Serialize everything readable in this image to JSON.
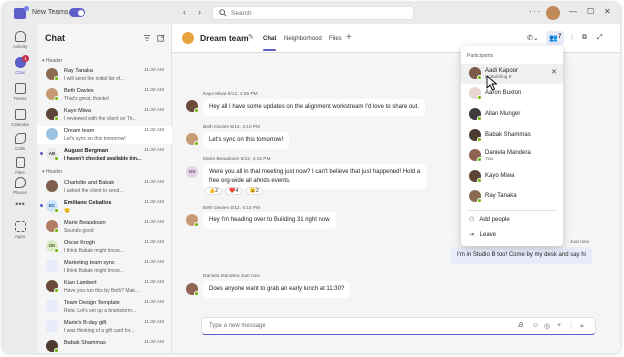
{
  "titlebar": {
    "app_name": "New Teams",
    "search_placeholder": "Search",
    "more": "···"
  },
  "rail": [
    {
      "label": "Activity",
      "active": false
    },
    {
      "label": "Chat",
      "active": true,
      "badge": "1"
    },
    {
      "label": "Teams",
      "active": false
    },
    {
      "label": "Calendar",
      "active": false
    },
    {
      "label": "Calls",
      "active": false
    },
    {
      "label": "Files",
      "active": false
    },
    {
      "label": "Places",
      "active": false
    },
    {
      "label": "Apps",
      "active": false
    }
  ],
  "rail_more": "•••",
  "chatlist": {
    "title": "Chat",
    "section1": "Header",
    "section2": "Header",
    "items": [
      {
        "initials": "",
        "name": "Ray Tanaka",
        "preview": "I will send the initial list of...",
        "time": "11:32 AM",
        "unread": false,
        "selected": false
      },
      {
        "initials": "",
        "name": "Beth Davies",
        "preview": "That's great, thanks!",
        "time": "11:32 AM",
        "unread": false,
        "selected": false
      },
      {
        "initials": "",
        "name": "Kayo Miwa",
        "preview": "I reviewed with the client on Th...",
        "time": "11:32 AM",
        "unread": false,
        "selected": false
      },
      {
        "initials": "",
        "name": "Dream team",
        "preview": "Let's sync on this tomorrow!",
        "time": "11:32 AM",
        "unread": false,
        "selected": true
      },
      {
        "initials": "AB",
        "name": "August Bergman",
        "preview": "I haven't checked available tim...",
        "time": "11:32 AM",
        "unread": true,
        "selected": false
      },
      {
        "initials": "",
        "name": "Charlotte and Babak",
        "preview": "I asked the client to send...",
        "time": "11:32 AM",
        "unread": false,
        "selected": false
      },
      {
        "initials": "EC",
        "name": "Emiliano Ceballos",
        "preview": "😊",
        "time": "11:32 AM",
        "unread": true,
        "selected": false
      },
      {
        "initials": "",
        "name": "Marie Beaudouin",
        "preview": "Sounds good",
        "time": "11:32 AM",
        "unread": false,
        "selected": false
      },
      {
        "initials": "OK",
        "name": "Oscar Krogh",
        "preview": "I think Babak might know...",
        "time": "11:32 AM",
        "unread": false,
        "selected": false
      },
      {
        "initials": "",
        "name": "Marketing team sync",
        "preview": "I think Babak might know...",
        "time": "11:32 AM",
        "unread": false,
        "selected": false
      },
      {
        "initials": "",
        "name": "Kian Lambert",
        "preview": "Have you run this by Beth? Mak...",
        "time": "11:32 AM",
        "unread": false,
        "selected": false
      },
      {
        "initials": "",
        "name": "Team Design Template",
        "preview": "Reta: Let's set up a brainstorm...",
        "time": "11:32 AM",
        "unread": false,
        "selected": false
      },
      {
        "initials": "",
        "name": "Marie's B-day gift",
        "preview": "I was thinking of a gift card for...",
        "time": "11:32 AM",
        "unread": false,
        "selected": false
      },
      {
        "initials": "",
        "name": "Babak Shammas",
        "preview": "",
        "time": "11:32 AM",
        "unread": false,
        "selected": false
      }
    ]
  },
  "header": {
    "title": "Dream team",
    "tabs": [
      "Chat",
      "Neighborhood",
      "Files"
    ],
    "add": "+",
    "participants_count": "7"
  },
  "messages": [
    {
      "meta": "Kayo Miwa   5/12, 4:05 PM",
      "text": "Hey all I have some updates on the alignment workstream I'd love to share out."
    },
    {
      "meta": "Beth Davies   5/12, 4:10 PM",
      "text": "Let's sync on this tomorrow!"
    },
    {
      "meta": "Marie Beaudouin   5/12, 4:15 PM",
      "avatar": "MB",
      "text1": "Were you all in that meeting just now? I can't believe that just happened! Hold a",
      "text2": "free org-wide all ahnds events."
    },
    {
      "meta": "Beth Davies   5/12, 4:15 PM",
      "text": "Hey I'm heading over to Building 31 right now"
    },
    {
      "meta": "Daniela Mandera   Just now",
      "text": "Does anyone want to grab an early lunch at 11:30?"
    }
  ],
  "reactions": [
    {
      "emoji": "👍",
      "count": "2"
    },
    {
      "emoji": "❤️",
      "count": "4"
    },
    {
      "emoji": "😮",
      "count": "2"
    }
  ],
  "my_message": {
    "meta": "Just now",
    "text": "I'm in Studio B too! Come by my desk and say hi"
  },
  "composer": {
    "placeholder": "Type a new message"
  },
  "participants": {
    "header": "Participants",
    "items": [
      {
        "name": "Aadi Kapoor",
        "sub": "In Building 8",
        "hover": true
      },
      {
        "name": "Aaron Buxton",
        "sub": "",
        "hover": false
      },
      {
        "name": "Allan Munger",
        "sub": "",
        "hover": false
      },
      {
        "name": "Babak Shammas",
        "sub": "",
        "hover": false
      },
      {
        "name": "Daniela Mandera",
        "sub": "You",
        "hover": false
      },
      {
        "name": "Kayo Miwa",
        "sub": "",
        "hover": false
      },
      {
        "name": "Ray Tanaka",
        "sub": "",
        "hover": false
      }
    ],
    "add_people": "Add people",
    "leave": "Leave"
  },
  "colors": {
    "accent": "#5b5fc7",
    "presence": "#6bb700",
    "my_bubble": "#e8ebfa"
  }
}
